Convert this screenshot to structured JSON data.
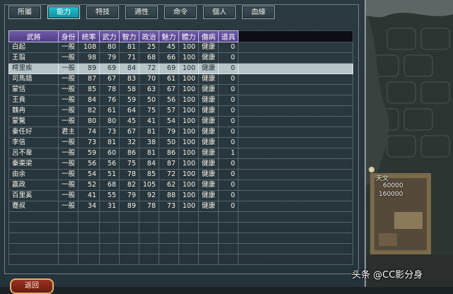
{
  "tabs": [
    {
      "label": "所屬",
      "active": false
    },
    {
      "label": "能力",
      "active": true
    },
    {
      "label": "特技",
      "active": false
    },
    {
      "label": "適性",
      "active": false
    },
    {
      "label": "命令",
      "active": false
    },
    {
      "label": "個人",
      "active": false
    },
    {
      "label": "血緣",
      "active": false
    }
  ],
  "table": {
    "columns": [
      "武將",
      "身份",
      "統率",
      "武力",
      "智力",
      "政治",
      "魅力",
      "體力",
      "傷病",
      "道具"
    ],
    "rows": [
      [
        "白起",
        "一般",
        "108",
        "80",
        "81",
        "25",
        "45",
        "100",
        "健康",
        "0"
      ],
      [
        "王翦",
        "一般",
        "98",
        "79",
        "71",
        "68",
        "66",
        "100",
        "健康",
        "0"
      ],
      [
        "樗里疾",
        "一般",
        "89",
        "69",
        "84",
        "72",
        "69",
        "100",
        "健康",
        "0"
      ],
      [
        "司馬錯",
        "一般",
        "87",
        "67",
        "83",
        "70",
        "61",
        "100",
        "健康",
        "0"
      ],
      [
        "蒙恬",
        "一般",
        "85",
        "78",
        "58",
        "63",
        "67",
        "100",
        "健康",
        "0"
      ],
      [
        "王賁",
        "一般",
        "84",
        "76",
        "59",
        "50",
        "56",
        "100",
        "健康",
        "0"
      ],
      [
        "魏冉",
        "一般",
        "82",
        "61",
        "64",
        "75",
        "57",
        "100",
        "健康",
        "0"
      ],
      [
        "蒙驁",
        "一般",
        "80",
        "80",
        "45",
        "41",
        "54",
        "100",
        "健康",
        "0"
      ],
      [
        "秦任好",
        "君主",
        "74",
        "73",
        "67",
        "81",
        "79",
        "100",
        "健康",
        "0"
      ],
      [
        "李信",
        "一般",
        "73",
        "81",
        "32",
        "38",
        "50",
        "100",
        "健康",
        "0"
      ],
      [
        "呂不韋",
        "一般",
        "59",
        "60",
        "86",
        "81",
        "86",
        "100",
        "健康",
        "1"
      ],
      [
        "秦渠梁",
        "一般",
        "56",
        "56",
        "75",
        "84",
        "87",
        "100",
        "健康",
        "0"
      ],
      [
        "由余",
        "一般",
        "54",
        "51",
        "78",
        "85",
        "72",
        "100",
        "健康",
        "0"
      ],
      [
        "嬴政",
        "一般",
        "52",
        "68",
        "82",
        "105",
        "62",
        "100",
        "健康",
        "0"
      ],
      [
        "百里奚",
        "一般",
        "41",
        "55",
        "79",
        "92",
        "88",
        "100",
        "健康",
        "0"
      ],
      [
        "蹇叔",
        "一般",
        "34",
        "31",
        "89",
        "78",
        "73",
        "100",
        "健康",
        "0"
      ]
    ],
    "selected_index": 2
  },
  "bottom_button": {
    "label": "返回"
  },
  "map": {
    "label_top": "天文",
    "value_1": "60000",
    "value_2": "160000"
  },
  "watermark": "头条 @CC影分身",
  "colors": {
    "active_tab": "#1dc6d6",
    "header": "#5a4895",
    "selected_row": "#b7c5c9"
  }
}
